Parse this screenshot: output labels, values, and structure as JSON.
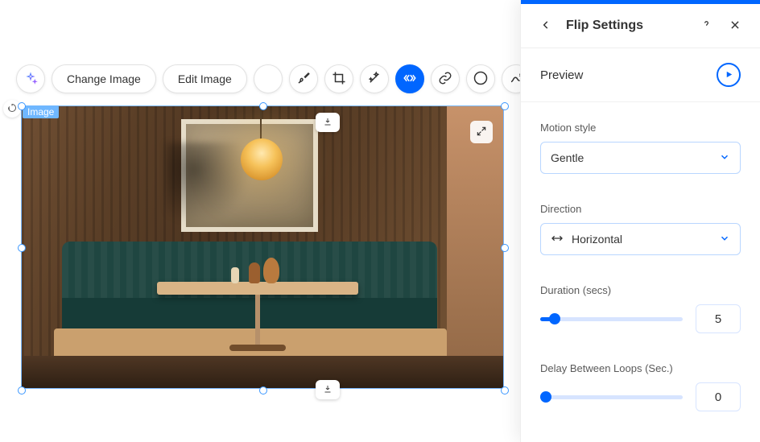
{
  "toolbar": {
    "change_image": "Change Image",
    "edit_image": "Edit Image"
  },
  "selection": {
    "label": "Image"
  },
  "panel": {
    "title": "Flip Settings",
    "preview": "Preview",
    "motion_style": {
      "label": "Motion style",
      "value": "Gentle"
    },
    "direction": {
      "label": "Direction",
      "value": "Horizontal"
    },
    "duration": {
      "label": "Duration (secs)",
      "value": "5",
      "fill_pct": 10
    },
    "delay": {
      "label": "Delay Between Loops (Sec.)",
      "value": "0",
      "fill_pct": 0
    }
  }
}
